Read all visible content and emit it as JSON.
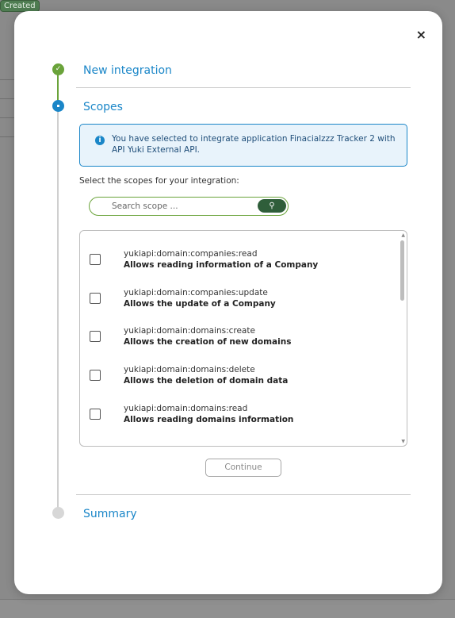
{
  "background": {
    "badge": "Created"
  },
  "modal": {
    "close_label": "×",
    "steps": [
      {
        "title": "New integration",
        "status": "done",
        "check": "✓"
      },
      {
        "title": "Scopes",
        "status": "active"
      },
      {
        "title": "Summary",
        "status": "todo"
      }
    ],
    "info_message": "You have selected to integrate application Finacialzzz Tracker 2 with API Yuki External API.",
    "info_icon": "i",
    "prompt": "Select the scopes for your integration:",
    "search": {
      "placeholder": "Search scope ...",
      "button_icon": "⚲"
    },
    "scopes": [
      {
        "name": "yukiapi:domain:companies:read",
        "description": "Allows reading information of a Company",
        "checked": false
      },
      {
        "name": "yukiapi:domain:companies:update",
        "description": "Allows the update of a Company",
        "checked": false
      },
      {
        "name": "yukiapi:domain:domains:create",
        "description": "Allows the creation of new domains",
        "checked": false
      },
      {
        "name": "yukiapi:domain:domains:delete",
        "description": "Allows the deletion of domain data",
        "checked": false
      },
      {
        "name": "yukiapi:domain:domains:read",
        "description": "Allows reading domains information",
        "checked": false
      }
    ],
    "continue_label": "Continue"
  },
  "colors": {
    "accent_blue": "#1a86c8",
    "done_green": "#6aa33a",
    "search_button": "#2f5e3a"
  }
}
